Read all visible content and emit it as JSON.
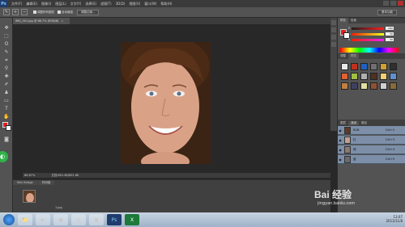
{
  "menubar": {
    "logo": "Ps",
    "items": [
      "文件(F)",
      "编辑(E)",
      "图像(I)",
      "图层(L)",
      "文字(Y)",
      "选择(S)",
      "滤镜(T)",
      "3D(D)",
      "视图(V)",
      "窗口(W)",
      "帮助(H)"
    ]
  },
  "options": {
    "sample_label": "调整所有图层",
    "auto_enhance_label": "自动增强",
    "refine_edge_label": "调整边缘...",
    "workspace_label": "基本功能"
  },
  "document": {
    "tab_title": "IMG_001.jpg @ 66.7% (RGB/8)",
    "zoom": "66.67%",
    "doc_info": "文档:891.6K/891.6K"
  },
  "minibridge": {
    "tabs": [
      "Mini Bridge",
      "时间轴"
    ],
    "item_label": "1.jpg"
  },
  "color_panel": {
    "tabs": [
      "颜色",
      "色板"
    ],
    "r": "240",
    "g": "30",
    "b": "30"
  },
  "styles_panel": {
    "tabs": [
      "调整",
      "样式"
    ]
  },
  "layers_panel": {
    "tabs": [
      "图层",
      "通道",
      "路径"
    ],
    "layers": [
      {
        "name": "RGB",
        "shortcut": "Ctrl+2"
      },
      {
        "name": "红",
        "shortcut": "Ctrl+3"
      },
      {
        "name": "绿",
        "shortcut": "Ctrl+4"
      },
      {
        "name": "蓝",
        "shortcut": "Ctrl+5"
      }
    ]
  },
  "taskbar": {
    "time": "13:07",
    "date": "2013/11/8"
  },
  "watermark": {
    "brand": "Bai 经验",
    "url": "jingyan.baidu.com"
  },
  "colors": {
    "foreground": "#e02020",
    "background": "#ffffff",
    "ps_accent": "#1f3d6d"
  }
}
